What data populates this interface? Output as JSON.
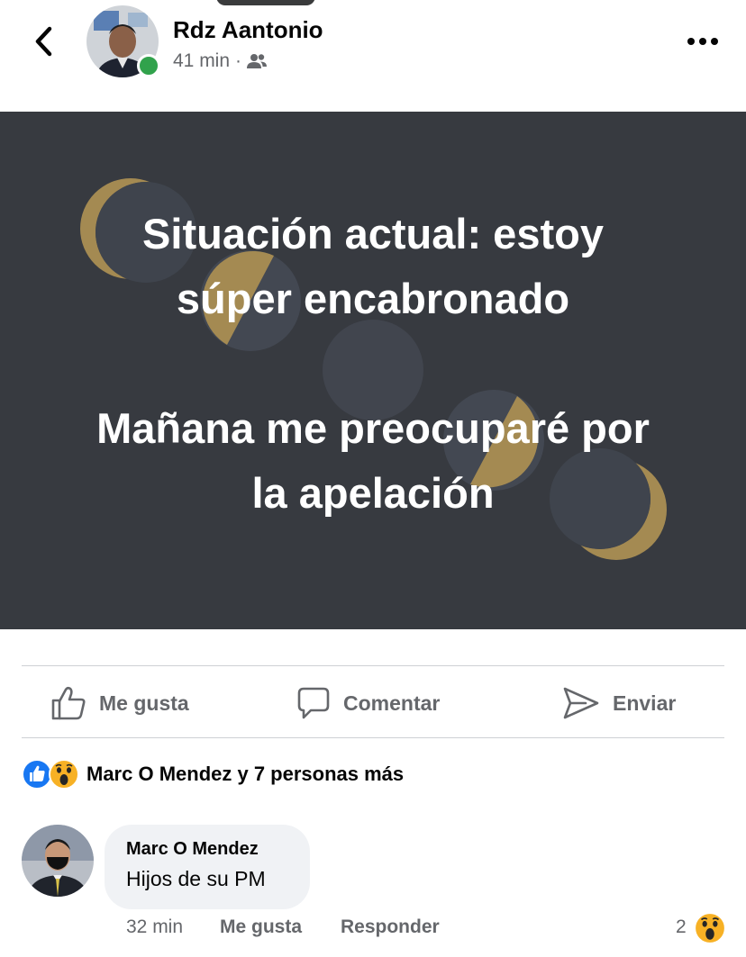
{
  "post": {
    "author": "Rdz Aantonio",
    "time": "41 min",
    "separator": "·",
    "audience_icon": "friends-icon",
    "text_line1": "Situación actual: estoy",
    "text_line2": "súper encabronado",
    "text_line3": "Mañana me preocuparé por",
    "text_line4": "la apelación",
    "background_color": "#373a40",
    "moon_color": "#a48a52"
  },
  "actions": {
    "like_label": "Me gusta",
    "comment_label": "Comentar",
    "send_label": "Enviar"
  },
  "reactions": {
    "types": [
      "like-reaction-icon",
      "wow-reaction-icon"
    ],
    "summary": "Marc O Mendez y 7 personas más"
  },
  "comment": {
    "author": "Marc O Mendez",
    "text": "Hijos de su PM",
    "time": "32 min",
    "like_label": "Me gusta",
    "reply_label": "Responder",
    "reaction_count": "2",
    "reaction_type": "wow-reaction-icon"
  },
  "colors": {
    "accent": "#1877f2",
    "online": "#31a24c",
    "secondary_text": "#65676b"
  }
}
